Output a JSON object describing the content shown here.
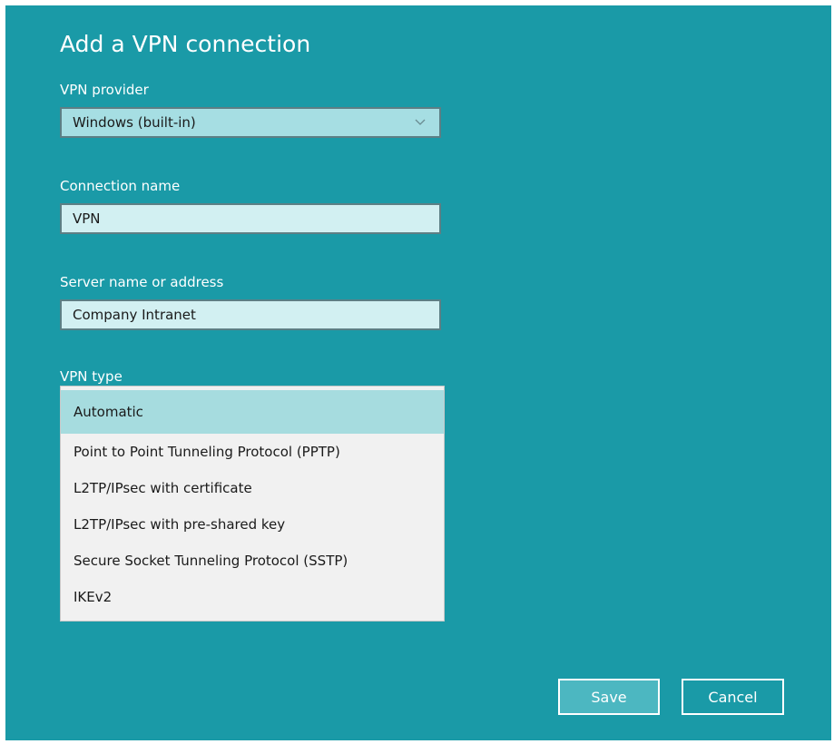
{
  "dialog": {
    "title": "Add a VPN connection"
  },
  "vpn_provider": {
    "label": "VPN provider",
    "selected": "Windows (built-in)"
  },
  "connection_name": {
    "label": "Connection name",
    "value": "VPN"
  },
  "server": {
    "label": "Server name or address",
    "value": "Company Intranet"
  },
  "vpn_type": {
    "label": "VPN type",
    "options": [
      "Automatic",
      "Point to Point Tunneling Protocol (PPTP)",
      "L2TP/IPsec with certificate",
      "L2TP/IPsec with pre-shared key",
      "Secure Socket Tunneling Protocol (SSTP)",
      "IKEv2"
    ],
    "selected_index": 0
  },
  "buttons": {
    "save": "Save",
    "cancel": "Cancel"
  },
  "colors": {
    "background": "#1a9aa7",
    "field": "#d2f0f2",
    "select_field": "#a6dee3",
    "dropdown": "#f1f1f1",
    "dropdown_selected": "#a6dcdf"
  },
  "icons": {
    "provider_dropdown": "chevron-down-icon"
  }
}
